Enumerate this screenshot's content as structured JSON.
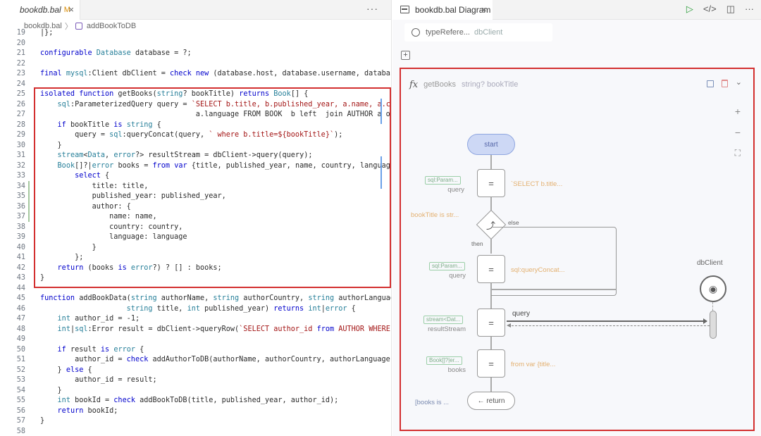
{
  "editor": {
    "tab": {
      "title": "bookdb.bal",
      "modified": "M",
      "close": "×"
    },
    "more": "···",
    "breadcrumb": {
      "file": "bookdb.bal",
      "sep": "〉",
      "symbol": "addBookToDB"
    },
    "lines": [
      {
        "n": "19",
        "t": "|};"
      },
      {
        "n": "20",
        "t": ""
      },
      {
        "n": "21",
        "t": "configurable Database database = ?;"
      },
      {
        "n": "22",
        "t": ""
      },
      {
        "n": "23",
        "t": "final mysql:Client dbClient = check new (database.host, database.username, database.p"
      },
      {
        "n": "24",
        "t": ""
      },
      {
        "n": "25",
        "t": "isolated function getBooks(string? bookTitle) returns Book[] {"
      },
      {
        "n": "26",
        "t": "    sql:ParameterizedQuery query = `SELECT b.title, b.published_year, a.name, a.count"
      },
      {
        "n": "27",
        "t": "                                    a.language FROM BOOK  b left  join AUTHOR a on b."
      },
      {
        "n": "28",
        "t": "    if bookTitle is string {"
      },
      {
        "n": "29",
        "t": "        query = sql:queryConcat(query, ` where b.title=${bookTitle}`);"
      },
      {
        "n": "30",
        "t": "    }"
      },
      {
        "n": "31",
        "t": "    stream<Data, error?> resultStream = dbClient->query(query);"
      },
      {
        "n": "32",
        "t": "    Book[]?|error books = from var {title, published_year, name, country, language} i"
      },
      {
        "n": "33",
        "t": "        select {"
      },
      {
        "n": "34",
        "t": "            title: title,"
      },
      {
        "n": "35",
        "t": "            published_year: published_year,"
      },
      {
        "n": "36",
        "t": "            author: {"
      },
      {
        "n": "37",
        "t": "                name: name,"
      },
      {
        "n": "38",
        "t": "                country: country,"
      },
      {
        "n": "39",
        "t": "                language: language"
      },
      {
        "n": "40",
        "t": "            }"
      },
      {
        "n": "41",
        "t": "        };"
      },
      {
        "n": "42",
        "t": "    return (books is error?) ? [] : books;"
      },
      {
        "n": "43",
        "t": "}"
      },
      {
        "n": "44",
        "t": ""
      },
      {
        "n": "45",
        "t": "function addBookData(string authorName, string authorCountry, string authorLanguage,"
      },
      {
        "n": "46",
        "t": "                    string title, int published_year) returns int|error {"
      },
      {
        "n": "47",
        "t": "    int author_id = -1;"
      },
      {
        "n": "48",
        "t": "    int|sql:Error result = dbClient->queryRow(`SELECT author_id from AUTHOR WHERE nam"
      },
      {
        "n": "49",
        "t": ""
      },
      {
        "n": "50",
        "t": "    if result is error {"
      },
      {
        "n": "51",
        "t": "        author_id = check addAuthorToDB(authorName, authorCountry, authorLanguage);"
      },
      {
        "n": "52",
        "t": "    } else {"
      },
      {
        "n": "53",
        "t": "        author_id = result;"
      },
      {
        "n": "54",
        "t": "    }"
      },
      {
        "n": "55",
        "t": "    int bookId = check addBookToDB(title, published_year, author_id);"
      },
      {
        "n": "56",
        "t": "    return bookId;"
      },
      {
        "n": "57",
        "t": "}"
      },
      {
        "n": "58",
        "t": ""
      }
    ]
  },
  "diagram": {
    "tab": {
      "title": "bookdb.bal Diagram",
      "close": "×"
    },
    "actions": {
      "run": "▷",
      "code": "</>",
      "split": "◫",
      "more": "···"
    },
    "typeref": {
      "label": "typeRefere...",
      "value": "dbClient"
    },
    "add": "+",
    "function": {
      "fx": "fx",
      "name": "getBooks",
      "params": "string? bookTitle",
      "chevron": "⌄"
    },
    "zoom": {
      "in": "+",
      "out": "−",
      "fit": "⛶"
    },
    "start": "start",
    "nodes": [
      {
        "type_tag": "sql:Param...",
        "var": "query",
        "expr": "`SELECT b.title..."
      },
      {
        "type_tag": "sql:Param...",
        "var": "query",
        "expr": "sql:queryConcat..."
      },
      {
        "type_tag": "stream<Dat...",
        "var": "resultStream",
        "expr": ""
      },
      {
        "type_tag": "Book[]?|er...",
        "var": "books",
        "expr": "from var {title..."
      }
    ],
    "node_symbol": "=",
    "if": {
      "condition": "bookTitle is str...",
      "else": "else",
      "then": "then",
      "icon": "⤴"
    },
    "endpoint": {
      "label": "dbClient",
      "icon": "◉"
    },
    "action_call": "query",
    "return": {
      "label": "← return",
      "expr": "[books is ..."
    }
  }
}
